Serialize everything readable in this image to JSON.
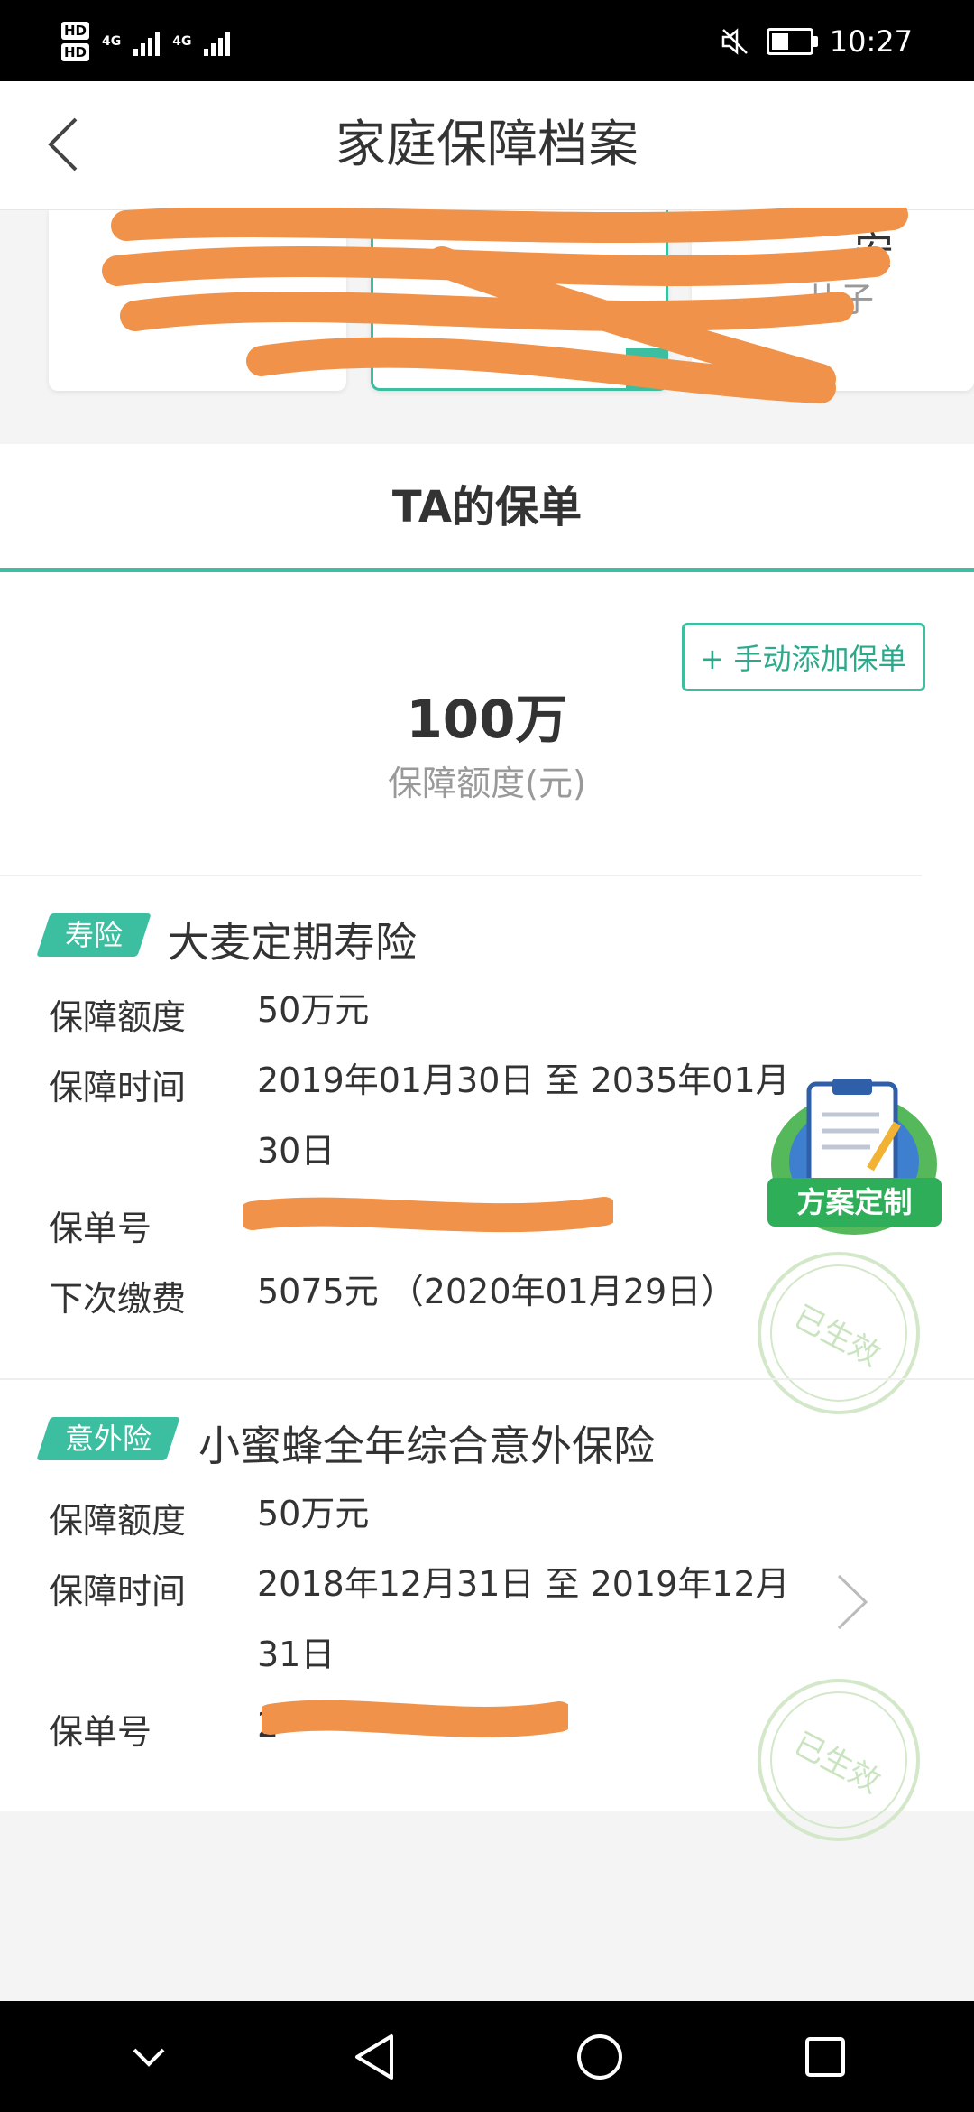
{
  "status_bar": {
    "hd1": "HD",
    "hd2": "HD",
    "net1": "4G",
    "net2": "4G",
    "time": "10:27",
    "icons": [
      "mute-icon",
      "battery-icon",
      "signal-icon"
    ]
  },
  "header": {
    "title": "家庭保障档案",
    "back_icon": "chevron-left-icon"
  },
  "members": [
    {
      "name": "",
      "relation": "",
      "selected": false
    },
    {
      "name": "",
      "relation": "",
      "selected": true
    },
    {
      "name": "安",
      "relation": "儿子",
      "selected": false
    }
  ],
  "section": {
    "title": "TA的保单",
    "add_button": "+ 手动添加保单",
    "total_amount": "100万",
    "total_label": "保障额度(元)"
  },
  "policies": [
    {
      "tag": "寿险",
      "name": "大麦定期寿险",
      "rows": [
        {
          "label": "保障额度",
          "value": "50万元"
        },
        {
          "label": "保障时间",
          "value": "2019年01月30日 至 2035年01月30日"
        },
        {
          "label": "保单号",
          "value": ""
        },
        {
          "label": "下次缴费",
          "value": "5075元 （2020年01月29日）"
        }
      ],
      "stamp": "已生效"
    },
    {
      "tag": "意外险",
      "name": "小蜜蜂全年综合意外保险",
      "rows": [
        {
          "label": "保障额度",
          "value": "50万元"
        },
        {
          "label": "保障时间",
          "value": "2018年12月31日 至 2019年12月31日"
        },
        {
          "label": "保单号",
          "value": "2"
        },
        {
          "label": "",
          "value": ""
        }
      ],
      "stamp": "已生效"
    }
  ],
  "floating_badge": {
    "label": "方案定制",
    "icon": "clipboard-icon"
  },
  "colors": {
    "accent": "#3cbfa0",
    "scribble": "#f0924a",
    "stamp": "#d3e8c9"
  }
}
